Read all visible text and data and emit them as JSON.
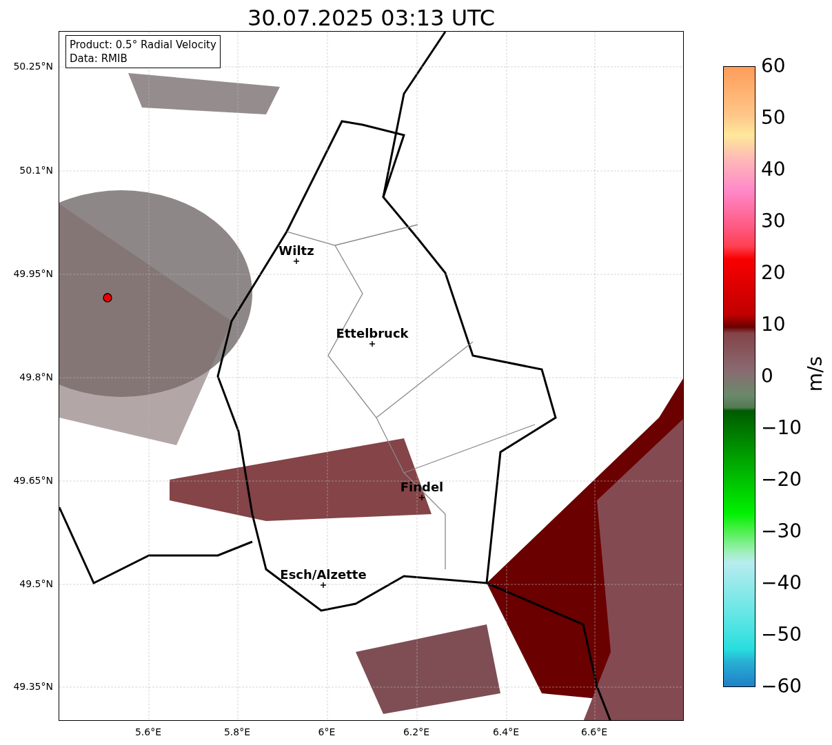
{
  "title": "30.07.2025 03:13 UTC",
  "info_box": [
    "Product: 0.5° Radial Velocity",
    "Data: RMIB"
  ],
  "map": {
    "cities": [
      {
        "name": "Wiltz"
      },
      {
        "name": "Ettelbruck"
      },
      {
        "name": "Findel"
      },
      {
        "name": "Esch/Alzette"
      }
    ]
  },
  "y_ticks": [
    "50.25°N",
    "50.1°N",
    "49.95°N",
    "49.8°N",
    "49.65°N",
    "49.5°N",
    "49.35°N"
  ],
  "x_ticks": [
    "5.6°E",
    "5.8°E",
    "6°E",
    "6.2°E",
    "6.4°E",
    "6.6°E"
  ],
  "colorbar": {
    "label": "m/s",
    "ticks": [
      "60",
      "50",
      "40",
      "30",
      "20",
      "10",
      "0",
      "−10",
      "−20",
      "−30",
      "−40",
      "−50",
      "−60"
    ]
  }
}
